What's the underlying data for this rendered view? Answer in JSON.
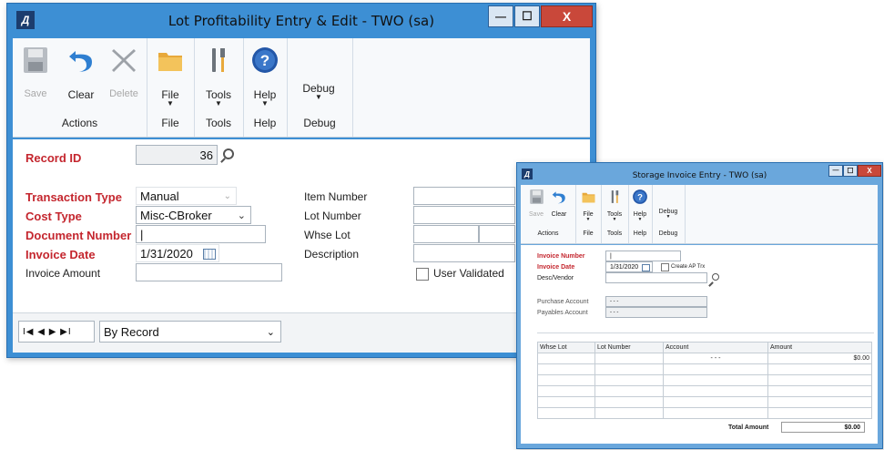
{
  "main": {
    "title": "Lot Profitability Entry & Edit  -  TWO (sa)",
    "app_icon": "Д",
    "controls": {
      "minimize": "—",
      "maximize": "☐",
      "close": "X"
    },
    "ribbon": {
      "actions": {
        "save": "Save",
        "clear": "Clear",
        "delete": "Delete",
        "group": "Actions"
      },
      "file": {
        "label": "File",
        "group": "File"
      },
      "tools": {
        "label": "Tools",
        "group": "Tools"
      },
      "help": {
        "label": "Help",
        "group": "Help"
      },
      "debug": {
        "label": "Debug",
        "group": "Debug"
      }
    },
    "form": {
      "record_id_label": "Record ID",
      "record_id_value": "36",
      "transaction_type_label": "Transaction Type",
      "transaction_type_value": "Manual",
      "cost_type_label": "Cost Type",
      "cost_type_value": "Misc-CBroker",
      "document_number_label": "Document Number",
      "document_number_value": "|",
      "invoice_date_label": "Invoice Date",
      "invoice_date_value": "1/31/2020",
      "invoice_amount_label": "Invoice Amount",
      "invoice_amount_value": "",
      "item_number_label": "Item Number",
      "lot_number_label": "Lot Number",
      "whse_lot_label": "Whse Lot",
      "description_label": "Description",
      "user_validated_label": "User Validated"
    },
    "nav": {
      "buttons": "I◀ ◀ ▶ ▶I",
      "browse_value": "By Record"
    }
  },
  "storage": {
    "title": "Storage Invoice Entry  -  TWO (sa)",
    "controls": {
      "minimize": "—",
      "maximize": "☐",
      "close": "X"
    },
    "ribbon": {
      "save": "Save",
      "clear": "Clear",
      "actions_group": "Actions",
      "file": "File",
      "tools": "Tools",
      "help": "Help",
      "debug": "Debug"
    },
    "form": {
      "invoice_number_label": "Invoice Number",
      "invoice_number_value": "|",
      "invoice_date_label": "Invoice Date",
      "invoice_date_value": "1/31/2020",
      "create_ap_label": "Create AP Trx",
      "desc_vendor_label": "Desc/Vendor",
      "purchase_account_label": "Purchase Account",
      "purchase_account_value": "-   -   -",
      "payables_account_label": "Payables Account",
      "payables_account_value": "-   -   -"
    },
    "grid": {
      "headers": [
        "Whse Lot",
        "Lot Number",
        "Account",
        "Amount"
      ],
      "first_row_account": "-   -   -",
      "first_row_amount": "$0.00",
      "total_label": "Total Amount",
      "total_value": "$0.00"
    }
  }
}
